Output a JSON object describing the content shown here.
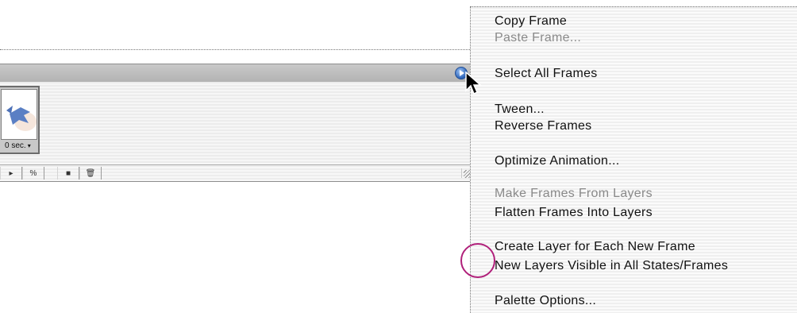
{
  "palette": {
    "frame": {
      "delay_label": "0 sec."
    },
    "toolbar_buttons": [
      "▸",
      "%",
      "■",
      "🗑"
    ]
  },
  "menu": {
    "items": [
      {
        "label": "Copy Frame",
        "enabled": true
      },
      {
        "label": "Paste Frame...",
        "enabled": false
      },
      {
        "label": "Select All Frames",
        "enabled": true
      },
      {
        "label": "Tween...",
        "enabled": true
      },
      {
        "label": "Reverse Frames",
        "enabled": true
      },
      {
        "label": "Optimize Animation...",
        "enabled": true
      },
      {
        "label": "Make Frames From Layers",
        "enabled": false
      },
      {
        "label": "Flatten Frames Into Layers",
        "enabled": true
      },
      {
        "label": "Create Layer for Each New Frame",
        "enabled": true
      },
      {
        "label": "New Layers Visible in All States/Frames",
        "enabled": true
      },
      {
        "label": "Palette Options...",
        "enabled": true
      }
    ]
  },
  "colors": {
    "highlight_ring": "#b0207a",
    "menu_button": "#2a62b8"
  }
}
